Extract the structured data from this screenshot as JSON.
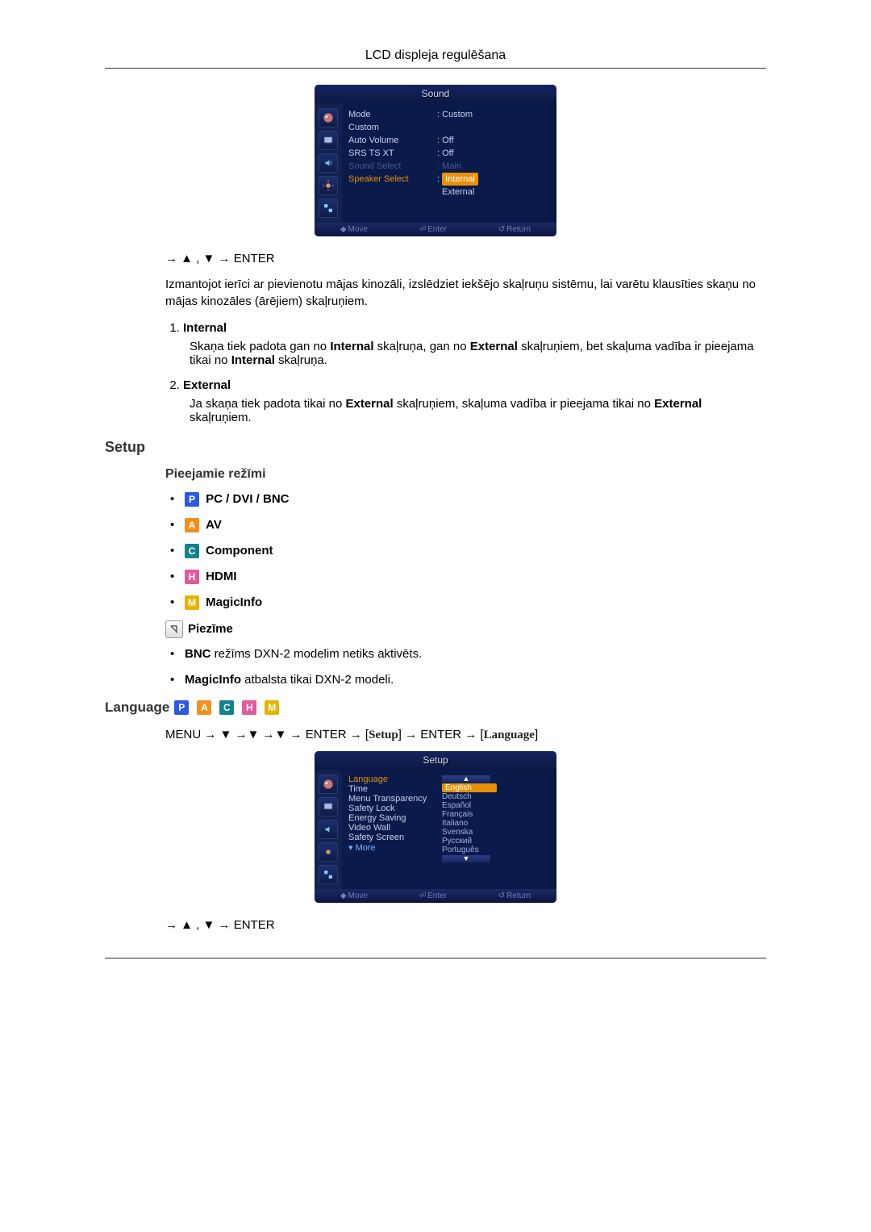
{
  "header": {
    "title": "LCD displeja regulēšana"
  },
  "osd_sound": {
    "title": "Sound",
    "rows": [
      {
        "label": "Mode",
        "value": "Custom",
        "disabled": false
      },
      {
        "label": "Custom",
        "value": "",
        "disabled": false
      },
      {
        "label": "Auto Volume",
        "value": "Off",
        "disabled": false
      },
      {
        "label": "SRS TS XT",
        "value": "Off",
        "disabled": false
      },
      {
        "label": "Sound Select",
        "value": "Main",
        "disabled": true
      },
      {
        "label": "Speaker Select",
        "value": "Internal",
        "disabled": false,
        "highlight": true
      },
      {
        "label": "",
        "value": "External",
        "disabled": false
      }
    ],
    "footer": {
      "move": "Move",
      "enter": "Enter",
      "ret": "Return"
    }
  },
  "nav1": "→ ▲ , ▼ → ENTER",
  "intro_paragraph": "Izmantojot ierīci ar pievienotu mājas kinozāli, izslēdziet iekšējo skaļruņu sistēmu, lai varētu klausīties skaņu no mājas kinozāles (ārējiem) skaļruņiem.",
  "speaker_items": [
    {
      "title": "Internal",
      "body_parts": [
        "Skaņa tiek padota gan no ",
        "Internal",
        " skaļruņa, gan no ",
        "External",
        " skaļruņiem, bet skaļuma vadība ir pieejama tikai no ",
        "Internal",
        " skaļruņa."
      ]
    },
    {
      "title": "External",
      "body_parts": [
        "Ja skaņa tiek padota tikai no ",
        "External",
        " skaļruņiem, skaļuma vadība ir pieejama tikai no ",
        "External",
        " skaļruņiem."
      ]
    }
  ],
  "setup_heading": "Setup",
  "modes_heading": "Pieejamie režīmi",
  "modes": [
    {
      "badge": "P",
      "color": "bg-blue",
      "label": "PC / DVI / BNC"
    },
    {
      "badge": "A",
      "color": "bg-orange",
      "label": "AV"
    },
    {
      "badge": "C",
      "color": "bg-cyan",
      "label": "Component"
    },
    {
      "badge": "H",
      "color": "bg-pink",
      "label": "HDMI"
    },
    {
      "badge": "M",
      "color": "bg-yellow",
      "label": "MagicInfo"
    }
  ],
  "note_label": "Piezīme",
  "notes": [
    {
      "bold": "BNC",
      "rest": " režīms DXN-2 modelim netiks aktivēts."
    },
    {
      "bold": "MagicInfo",
      "rest": " atbalsta tikai DXN-2 modeli."
    }
  ],
  "language_heading": "Language",
  "menu_path": {
    "p1": "MENU → ▼ →▼ →▼ → ENTER → [",
    "setup": "Setup",
    "p2": "] → ENTER → [",
    "lang": "Language",
    "p3": "]"
  },
  "osd_setup": {
    "title": "Setup",
    "labels": [
      "Language",
      "Time",
      "Menu Transparency",
      "Safety Lock",
      "Energy Saving",
      "Video Wall",
      "Safety Screen"
    ],
    "more": "More",
    "options": [
      "English",
      "Deutsch",
      "Español",
      "Français",
      "Italiano",
      "Svenska",
      "Русский",
      "Português"
    ],
    "footer": {
      "move": "Move",
      "enter": "Enter",
      "ret": "Return"
    }
  },
  "nav2": "→ ▲ , ▼ → ENTER"
}
